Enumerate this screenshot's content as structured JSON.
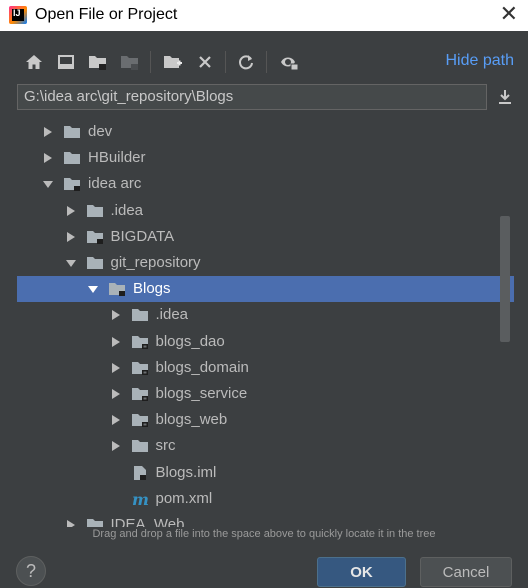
{
  "window": {
    "title": "Open File or Project",
    "app_icon_text": "IJ",
    "close_glyph": "✕"
  },
  "toolbar": {
    "icons": [
      "home-icon",
      "desktop-icon",
      "project-folder-icon",
      "module-folder-icon",
      "new-folder-icon",
      "delete-icon",
      "refresh-icon",
      "show-hidden-icon"
    ],
    "hide_path_label": "Hide path"
  },
  "path": {
    "value": "G:\\idea arc\\git_repository\\Blogs"
  },
  "tree": {
    "items": [
      {
        "label": "dev",
        "depth": 0,
        "arrow": "right",
        "icon": "folder-icon"
      },
      {
        "label": "HBuilder",
        "depth": 0,
        "arrow": "right",
        "icon": "folder-icon"
      },
      {
        "label": "idea arc",
        "depth": 0,
        "arrow": "down",
        "icon": "project-folder-icon"
      },
      {
        "label": ".idea",
        "depth": 1,
        "arrow": "right",
        "icon": "folder-icon"
      },
      {
        "label": "BIGDATA",
        "depth": 1,
        "arrow": "right",
        "icon": "project-folder-icon"
      },
      {
        "label": "git_repository",
        "depth": 1,
        "arrow": "down",
        "icon": "folder-icon"
      },
      {
        "label": "Blogs",
        "depth": 2,
        "arrow": "down",
        "icon": "project-folder-icon",
        "selected": true
      },
      {
        "label": ".idea",
        "depth": 3,
        "arrow": "right",
        "icon": "folder-icon"
      },
      {
        "label": "blogs_dao",
        "depth": 3,
        "arrow": "right",
        "icon": "module-folder-icon"
      },
      {
        "label": "blogs_domain",
        "depth": 3,
        "arrow": "right",
        "icon": "module-folder-icon"
      },
      {
        "label": "blogs_service",
        "depth": 3,
        "arrow": "right",
        "icon": "module-folder-icon"
      },
      {
        "label": "blogs_web",
        "depth": 3,
        "arrow": "right",
        "icon": "module-folder-icon"
      },
      {
        "label": "src",
        "depth": 3,
        "arrow": "right",
        "icon": "folder-icon"
      },
      {
        "label": "Blogs.iml",
        "depth": 3,
        "arrow": "none",
        "icon": "iml-file-icon"
      },
      {
        "label": "pom.xml",
        "depth": 3,
        "arrow": "none",
        "icon": "maven-file-icon"
      },
      {
        "label": "IDEA_Web",
        "depth": 1,
        "arrow": "right",
        "icon": "project-folder-icon"
      }
    ]
  },
  "hint": "Drag and drop a file into the space above to quickly locate it in the tree",
  "footer": {
    "help_label": "?",
    "ok_label": "OK",
    "cancel_label": "Cancel"
  },
  "colors": {
    "background": "#3c3f41",
    "selection": "#4b6eaf",
    "link": "#589df6",
    "ok_button": "#365880"
  }
}
